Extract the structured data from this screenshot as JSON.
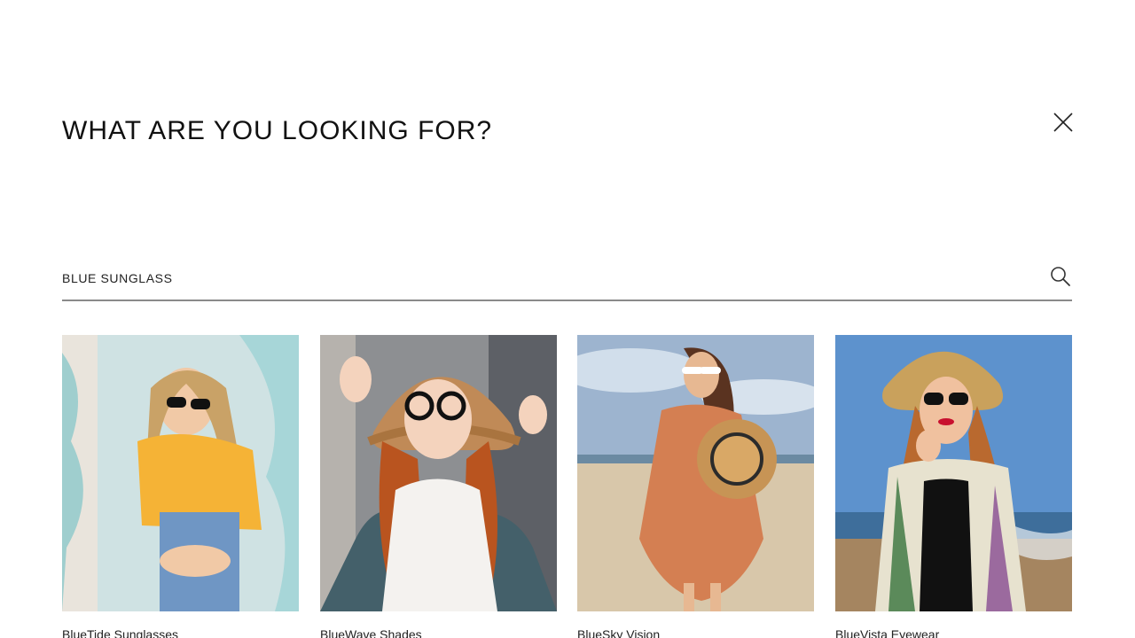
{
  "search_overlay": {
    "title": "WHAT ARE YOU LOOKING FOR?",
    "close_icon": "close-icon",
    "search": {
      "value": "BLUE SUNGLASS",
      "placeholder": "",
      "icon": "search-icon"
    }
  },
  "results": [
    {
      "name": "BlueTide Sunglasses",
      "image": "woman-yellow-shirt-sunglasses"
    },
    {
      "name": "BlueWave Shades",
      "image": "woman-hat-round-glasses"
    },
    {
      "name": "BlueSky Vision",
      "image": "woman-beach-cateye-sunglasses"
    },
    {
      "name": "BlueVista Eyewear",
      "image": "woman-straw-hat-sunglasses-sea"
    }
  ],
  "colors": {
    "background": "#ffffff",
    "text": "#111111",
    "underline": "#8a8a8a"
  }
}
